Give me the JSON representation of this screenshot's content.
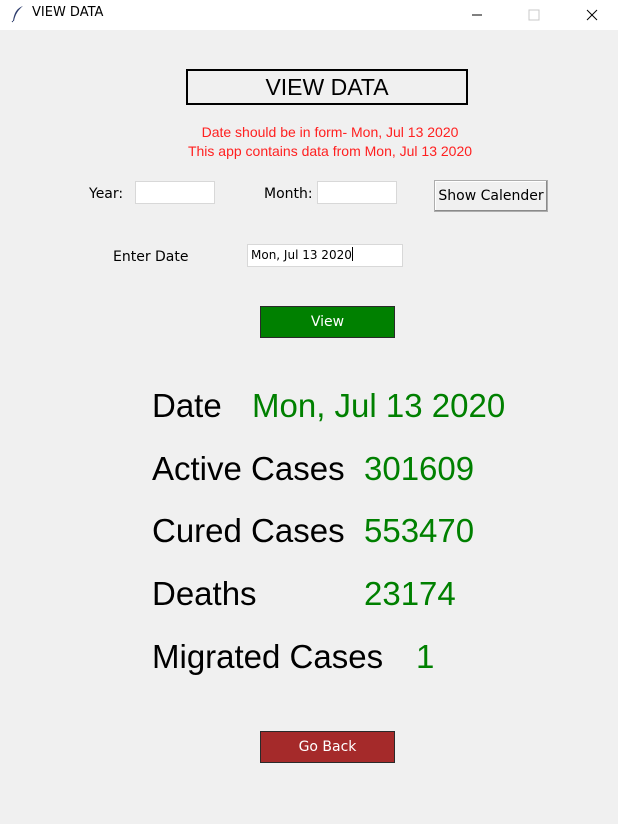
{
  "window": {
    "title": "VIEW DATA",
    "icon": "feather-icon",
    "controls": [
      "minimize-icon",
      "maximize-icon",
      "close-icon"
    ]
  },
  "heading": "VIEW DATA",
  "notices": {
    "format": "Date should be in form- Mon, Jul 13 2020",
    "range": "This app contains data from Mon, Jul 13 2020"
  },
  "calendar": {
    "year_label": "Year:",
    "year_value": "",
    "month_label": "Month:",
    "month_value": "",
    "show_button": "Show Calender"
  },
  "date_entry": {
    "label": "Enter Date",
    "value": "Mon, Jul 13 2020"
  },
  "view_button": "View",
  "results": {
    "date_label": "Date",
    "date_value": "Mon, Jul 13 2020",
    "active_label": "Active Cases",
    "active_value": "301609",
    "cured_label": "Cured Cases",
    "cured_value": "553470",
    "deaths_label": "Deaths",
    "deaths_value": "23174",
    "migrated_label": "Migrated Cases",
    "migrated_value": "1"
  },
  "back_button": "Go Back",
  "colors": {
    "notice": "#ff2020",
    "value": "#008000",
    "view_button": "#008000",
    "back_button": "#a52a2a",
    "background": "#f0f0f0"
  }
}
